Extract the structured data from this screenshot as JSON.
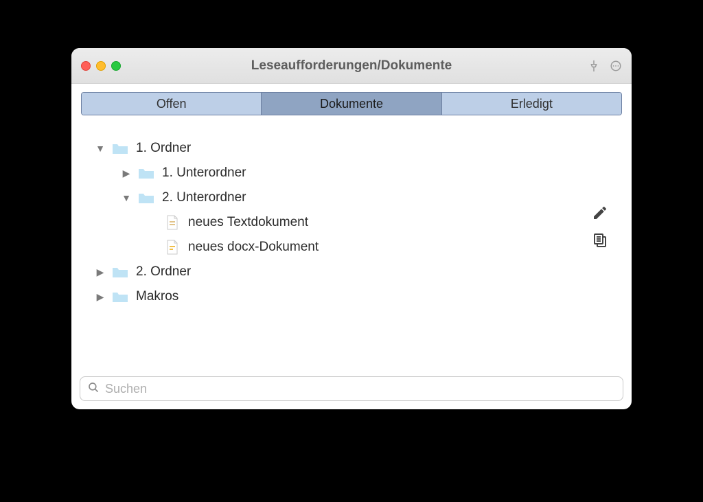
{
  "window": {
    "title": "Leseaufforderungen/Dokumente"
  },
  "tabs": [
    {
      "label": "Offen",
      "active": false
    },
    {
      "label": "Dokumente",
      "active": true
    },
    {
      "label": "Erledigt",
      "active": false
    }
  ],
  "tree": [
    {
      "label": "1. Ordner",
      "kind": "folder",
      "depth": 0,
      "expanded": true
    },
    {
      "label": "1. Unterordner",
      "kind": "folder",
      "depth": 1,
      "expanded": false
    },
    {
      "label": "2. Unterordner",
      "kind": "folder",
      "depth": 1,
      "expanded": true
    },
    {
      "label": "neues Textdokument",
      "kind": "file",
      "depth": 2,
      "expanded": null
    },
    {
      "label": "neues docx-Dokument",
      "kind": "file",
      "depth": 2,
      "expanded": null
    },
    {
      "label": "2. Ordner",
      "kind": "folder",
      "depth": 0,
      "expanded": false
    },
    {
      "label": "Makros",
      "kind": "folder",
      "depth": 0,
      "expanded": false
    }
  ],
  "search": {
    "placeholder": "Suchen",
    "value": ""
  }
}
